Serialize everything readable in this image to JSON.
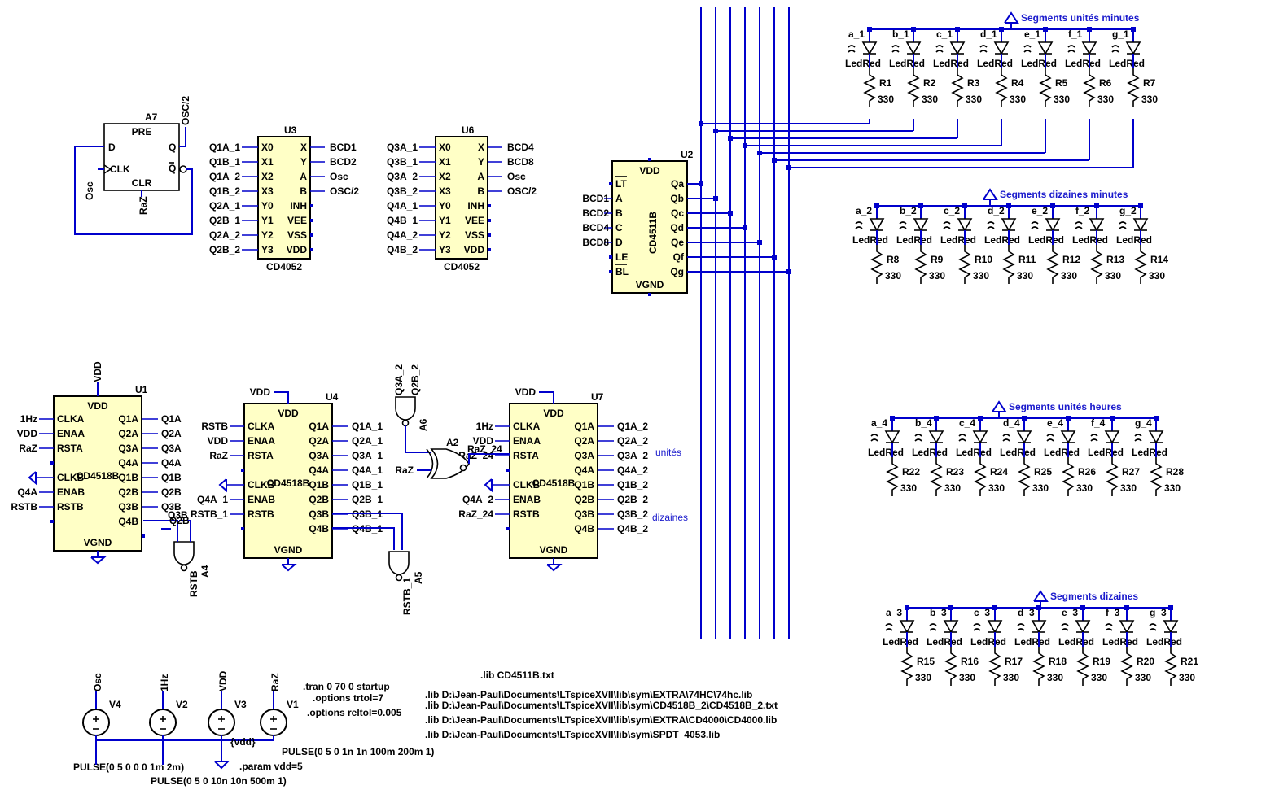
{
  "a7": {
    "ref": "A7",
    "pins": {
      "pre": "PRE",
      "d": "D",
      "q": "Q",
      "qbar": "Q",
      "clk": "CLK",
      "clr": "CLR"
    },
    "nets": {
      "osc": "Osc",
      "raz": "RaZ",
      "osc2": "OSC/2"
    }
  },
  "u3": {
    "ref": "U3",
    "part": "CD4052",
    "left": [
      "Q1A_1",
      "Q1B_1",
      "Q1A_2",
      "Q1B_2",
      "Q2A_1",
      "Q2B_1",
      "Q2A_2",
      "Q2B_2"
    ],
    "pl": [
      "X0",
      "X1",
      "X2",
      "X3",
      "Y0",
      "Y1",
      "Y2",
      "Y3"
    ],
    "pr": [
      "X",
      "Y",
      "A",
      "B",
      "INH",
      "VEE",
      "VSS",
      "VDD"
    ],
    "right": [
      "BCD1",
      "BCD2",
      "Osc",
      "OSC/2"
    ]
  },
  "u6": {
    "ref": "U6",
    "part": "CD4052",
    "left": [
      "Q3A_1",
      "Q3B_1",
      "Q3A_2",
      "Q3B_2",
      "Q4A_1",
      "Q4B_1",
      "Q4A_2",
      "Q4B_2"
    ],
    "pl": [
      "X0",
      "X1",
      "X2",
      "X3",
      "Y0",
      "Y1",
      "Y2",
      "Y3"
    ],
    "pr": [
      "X",
      "Y",
      "A",
      "B",
      "INH",
      "VEE",
      "VSS",
      "VDD"
    ],
    "right": [
      "BCD4",
      "BCD8",
      "Osc",
      "OSC/2"
    ]
  },
  "u2": {
    "ref": "U2",
    "part": "CD4511B",
    "vdd": "VDD",
    "vgnd": "VGND",
    "pl": [
      "LT",
      "A",
      "B",
      "C",
      "D",
      "LE",
      "BL"
    ],
    "left": [
      "BCD1",
      "BCD2",
      "BCD4",
      "BCD8"
    ],
    "pr": [
      "Qa",
      "Qb",
      "Qc",
      "Qd",
      "Qe",
      "Qf",
      "Qg"
    ]
  },
  "u1": {
    "ref": "U1",
    "part": "CD4518B",
    "vdd": "VDD",
    "vgnd": "VGND",
    "topnet": "VDD",
    "pl": [
      "CLKA",
      "ENAA",
      "RSTA",
      "",
      "CLKB",
      "ENAB",
      "RSTB",
      ""
    ],
    "left": [
      "1Hz",
      "VDD",
      "RaZ",
      "",
      "",
      "Q4A",
      "RSTB",
      ""
    ],
    "pr": [
      "Q1A",
      "Q2A",
      "Q3A",
      "Q4A",
      "Q1B",
      "Q2B",
      "Q3B",
      "Q4B"
    ],
    "right": [
      "Q1A",
      "Q2A",
      "Q3A",
      "Q4A",
      "Q1B",
      "Q2B",
      "Q3B",
      ""
    ]
  },
  "u4": {
    "ref": "U4",
    "part": "CD4518B",
    "vdd": "VDD",
    "vgnd": "VGND",
    "topnet": "VDD",
    "pl": [
      "CLKA",
      "ENAA",
      "RSTA",
      "",
      "CLKB",
      "ENAB",
      "RSTB",
      ""
    ],
    "left": [
      "RSTB",
      "VDD",
      "RaZ",
      "",
      "",
      "Q4A_1",
      "RSTB_1",
      ""
    ],
    "pr": [
      "Q1A",
      "Q2A",
      "Q3A",
      "Q4A",
      "Q1B",
      "Q2B",
      "Q3B",
      "Q4B"
    ],
    "right": [
      "Q1A_1",
      "Q2A_1",
      "Q3A_1",
      "Q4A_1",
      "Q1B_1",
      "Q2B_1",
      "Q3B_1",
      "Q4B_1"
    ]
  },
  "u7": {
    "ref": "U7",
    "part": "CD4518B",
    "vdd": "VDD",
    "vgnd": "VGND",
    "topnet": "VDD",
    "pl": [
      "CLKA",
      "ENAA",
      "RSTA",
      "",
      "CLKB",
      "ENAB",
      "RSTB",
      ""
    ],
    "left": [
      "1Hz",
      "VDD",
      "RaZ_24",
      "",
      "",
      "Q4A_2",
      "RaZ_24",
      ""
    ],
    "pr": [
      "Q1A",
      "Q2A",
      "Q3A",
      "Q4A",
      "Q1B",
      "Q2B",
      "Q3B",
      "Q4B"
    ],
    "right": [
      "Q1A_2",
      "Q2A_2",
      "Q3A_2",
      "Q4A_2",
      "Q1B_2",
      "Q2B_2",
      "Q3B_2",
      "Q4B_2"
    ]
  },
  "gates": {
    "a4": "A4",
    "a5": "A5",
    "a6": "A6",
    "a2": "A2",
    "a4_in": "Q2B",
    "a4_in2": "Q3B",
    "a4_out": "RSTB",
    "a5_in": "Q2B_1",
    "a5_in2": "Q3B_1",
    "a5_out": "RSTB_1",
    "a6_in": "Q3A_2",
    "a6_in2": "Q2B_2",
    "a2_in": "RaZ",
    "a2_out": "RaZ_24"
  },
  "labels": {
    "unites": "unités",
    "dizaines": "dizaines"
  },
  "segments": {
    "banks": [
      {
        "title": "Segments unités minutes",
        "leds": [
          "a_1",
          "b_1",
          "c_1",
          "d_1",
          "e_1",
          "f_1",
          "g_1"
        ],
        "res": [
          "R1",
          "R2",
          "R3",
          "R4",
          "R5",
          "R6",
          "R7"
        ]
      },
      {
        "title": "Segments dizaines minutes",
        "leds": [
          "a_2",
          "b_2",
          "c_2",
          "d_2",
          "e_2",
          "f_2",
          "g_2"
        ],
        "res": [
          "R8",
          "R9",
          "R10",
          "R11",
          "R12",
          "R13",
          "R14"
        ]
      },
      {
        "title": "Segments unités heures",
        "leds": [
          "a_4",
          "b_4",
          "c_4",
          "d_4",
          "e_4",
          "f_4",
          "g_4"
        ],
        "res": [
          "R22",
          "R23",
          "R24",
          "R25",
          "R26",
          "R27",
          "R28"
        ]
      },
      {
        "title": "Segments dizaines",
        "leds": [
          "a_3",
          "b_3",
          "c_3",
          "d_3",
          "e_3",
          "f_3",
          "g_3"
        ],
        "res": [
          "R15",
          "R16",
          "R17",
          "R18",
          "R19",
          "R20",
          "R21"
        ]
      }
    ],
    "led_model": "LedRed",
    "res_value": "330"
  },
  "sources": [
    {
      "ref": "V4",
      "net": "Osc",
      "value": "PULSE(0 5 0 0 0 1m 2m)"
    },
    {
      "ref": "V2",
      "net": "1Hz",
      "value": "PULSE(0 5 0 10n 10n 500m 1)"
    },
    {
      "ref": "V3",
      "net": "VDD",
      "value": "{vdd}"
    },
    {
      "ref": "V1",
      "net": "RaZ",
      "value": "PULSE(0 5 0 1n 1n 100m 200m 1)"
    }
  ],
  "directives": {
    "tran": ".tran 0 70 0 startup",
    "trtol": ".options trtol=7",
    "reltol": ".options reltol=0.005",
    "param": ".param vdd=5",
    "lib0": ".lib CD4511B.txt",
    "lib1": ".lib D:\\Jean-Paul\\Documents\\LTspiceXVII\\lib\\sym\\EXTRA\\74HC\\74hc.lib",
    "lib2": ".lib D:\\Jean-Paul\\Documents\\LTspiceXVII\\lib\\sym\\CD4518B_2\\CD4518B_2.txt",
    "lib3": ".lib D:\\Jean-Paul\\Documents\\LTspiceXVII\\lib\\sym\\EXTRA\\CD4000\\CD4000.lib",
    "lib4": ".lib D:\\Jean-Paul\\Documents\\LTspiceXVII\\lib\\sym\\SPDT_4053.lib"
  }
}
